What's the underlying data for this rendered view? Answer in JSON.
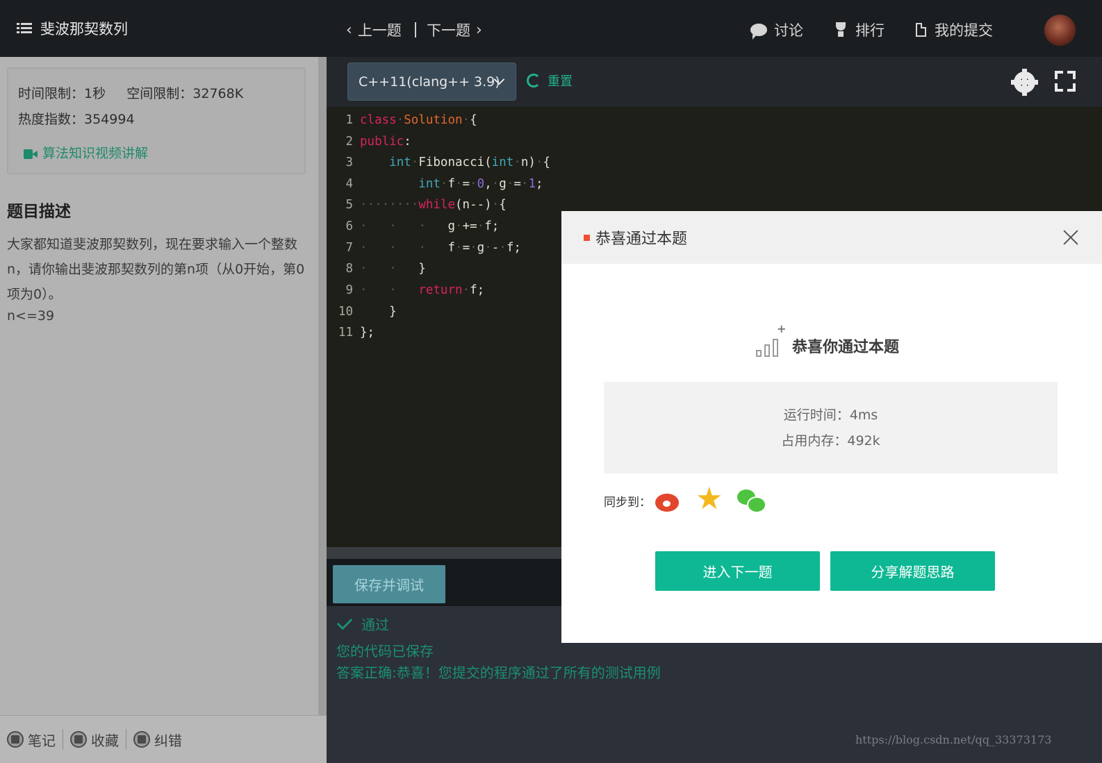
{
  "left_panel": {
    "title": "斐波那契数列",
    "time_limit": "时间限制：1秒",
    "space_limit": "空间限制：32768K",
    "hot_index": "热度指数：354994",
    "video_link": "算法知识视频讲解",
    "desc_heading": "题目描述",
    "desc_text": "大家都知道斐波那契数列，现在要求输入一个整数n，请你输出斐波那契数列的第n项（从0开始，第0项为0）。",
    "desc_constraint": "n<=39",
    "footer": {
      "notes": "笔记",
      "favorite": "收藏",
      "correct": "纠错"
    }
  },
  "topnav": {
    "prev": "上一题",
    "next": "下一题",
    "discuss": "讨论",
    "rank": "排行",
    "my_submissions": "我的提交"
  },
  "editor": {
    "language": "C++11(clang++ 3.9)",
    "reset": "重置",
    "line_numbers": [
      "1",
      "2",
      "3",
      "4",
      "5",
      "6",
      "7",
      "8",
      "9",
      "10",
      "11"
    ]
  },
  "actions": {
    "save_debug": "保存并调试",
    "status": "通过",
    "saved_msg": "您的代码已保存",
    "correct_msg": "答案正确:恭喜！您提交的程序通过了所有的测试用例"
  },
  "modal": {
    "title": "恭喜通过本题",
    "heading": "恭喜你通过本题",
    "run_time": "运行时间：4ms",
    "memory": "占用内存：492k",
    "share_label": "同步到：",
    "next_button": "进入下一题",
    "share_button": "分享解题思路"
  },
  "watermark": "https://blog.csdn.net/qq_33373173",
  "colors": {
    "accent": "#0eb894",
    "success_text": "#1a8f73",
    "header_bg": "#1b1e21"
  }
}
